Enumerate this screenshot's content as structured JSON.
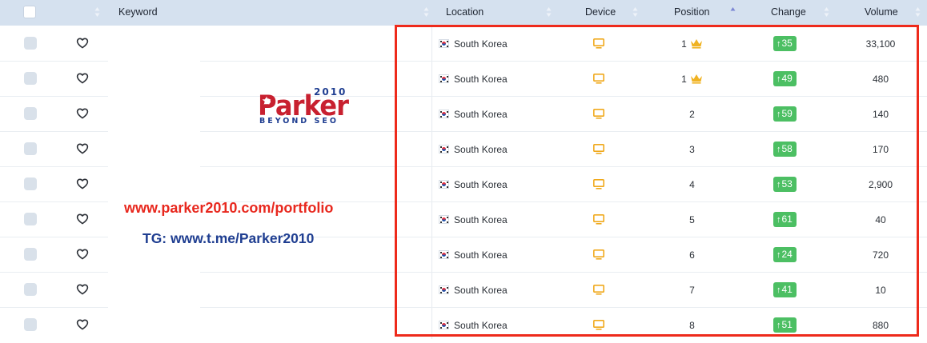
{
  "header": {
    "keyword": "Keyword",
    "location": "Location",
    "device": "Device",
    "position": "Position",
    "change": "Change",
    "volume": "Volume",
    "sorted_column": "Position",
    "sort_direction": "ascending"
  },
  "colors": {
    "header_bg": "#d5e1ef",
    "change_badge": "#4cbf63",
    "device_icon": "#f0a91c",
    "crown": "#f0b323",
    "highlight_border": "#ee2a1b"
  },
  "icons": {
    "row_favorite": "heart-outline-icon",
    "device": "desktop-monitor-icon",
    "top_rank": "crown-icon",
    "change_up": "arrow-up-icon",
    "location_flag": "south-korea-flag-icon"
  },
  "rows": [
    {
      "location": "South Korea",
      "position": "1",
      "crown": true,
      "change": "35",
      "volume": "33,100"
    },
    {
      "location": "South Korea",
      "position": "1",
      "crown": true,
      "change": "49",
      "volume": "480"
    },
    {
      "location": "South Korea",
      "position": "2",
      "crown": false,
      "change": "59",
      "volume": "140"
    },
    {
      "location": "South Korea",
      "position": "3",
      "crown": false,
      "change": "58",
      "volume": "170"
    },
    {
      "location": "South Korea",
      "position": "4",
      "crown": false,
      "change": "53",
      "volume": "2,900"
    },
    {
      "location": "South Korea",
      "position": "5",
      "crown": false,
      "change": "61",
      "volume": "40"
    },
    {
      "location": "South Korea",
      "position": "6",
      "crown": false,
      "change": "24",
      "volume": "720"
    },
    {
      "location": "South Korea",
      "position": "7",
      "crown": false,
      "change": "41",
      "volume": "10"
    },
    {
      "location": "South Korea",
      "position": "8",
      "crown": false,
      "change": "51",
      "volume": "880"
    }
  ],
  "watermark": {
    "logo_name": "Parker",
    "logo_year": "2010",
    "logo_tagline": "BEYOND SEO",
    "url": "www.parker2010.com/portfolio",
    "telegram": "TG: www.t.me/Parker2010"
  }
}
